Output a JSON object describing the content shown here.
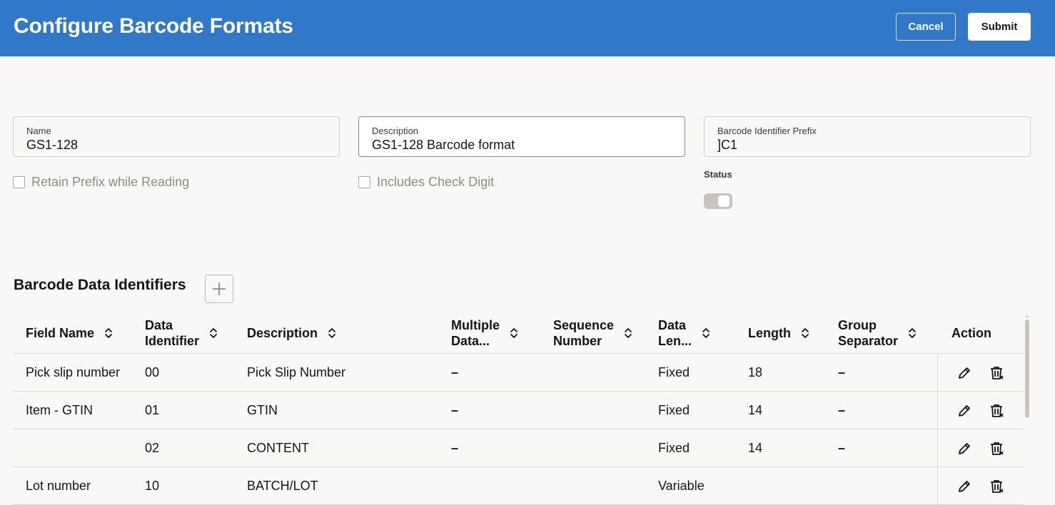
{
  "header": {
    "title": "Configure Barcode Formats",
    "cancel_label": "Cancel",
    "submit_label": "Submit"
  },
  "form": {
    "name": {
      "label": "Name",
      "value": "GS1-128"
    },
    "description": {
      "label": "Description",
      "value": "GS1-128 Barcode format"
    },
    "prefix": {
      "label": "Barcode Identifier Prefix",
      "value": "]C1"
    },
    "retain_prefix": {
      "label": "Retain Prefix while Reading",
      "checked": false
    },
    "check_digit": {
      "label": "Includes Check Digit",
      "checked": false
    },
    "status": {
      "label": "Status",
      "enabled": false
    }
  },
  "section": {
    "title": "Barcode Data Identifiers"
  },
  "table": {
    "columns": [
      {
        "line1": "Field Name",
        "line2": ""
      },
      {
        "line1": "Data",
        "line2": "Identifier"
      },
      {
        "line1": "Description",
        "line2": ""
      },
      {
        "line1": "Multiple",
        "line2": "Data..."
      },
      {
        "line1": "Sequence",
        "line2": "Number"
      },
      {
        "line1": "Data",
        "line2": "Len..."
      },
      {
        "line1": "Length",
        "line2": ""
      },
      {
        "line1": "Group",
        "line2": "Separator"
      },
      {
        "line1": "Action",
        "line2": ""
      }
    ],
    "rows": [
      {
        "field_name": "Pick slip number",
        "data_identifier": "00",
        "description": "Pick Slip Number",
        "multiple": "–",
        "sequence": "",
        "data_length": "Fixed",
        "length": "18",
        "group_separator": "–"
      },
      {
        "field_name": "Item - GTIN",
        "data_identifier": "01",
        "description": "GTIN",
        "multiple": "–",
        "sequence": "",
        "data_length": "Fixed",
        "length": "14",
        "group_separator": "–"
      },
      {
        "field_name": "",
        "data_identifier": "02",
        "description": "CONTENT",
        "multiple": "–",
        "sequence": "",
        "data_length": "Fixed",
        "length": "14",
        "group_separator": "–"
      },
      {
        "field_name": "Lot number",
        "data_identifier": "10",
        "description": "BATCH/LOT",
        "multiple": "",
        "sequence": "",
        "data_length": "Variable",
        "length": "",
        "group_separator": ""
      }
    ]
  },
  "icons": {
    "sort": "sort-icon",
    "edit": "pencil-icon",
    "delete": "trash-icon",
    "add": "plus-icon"
  }
}
